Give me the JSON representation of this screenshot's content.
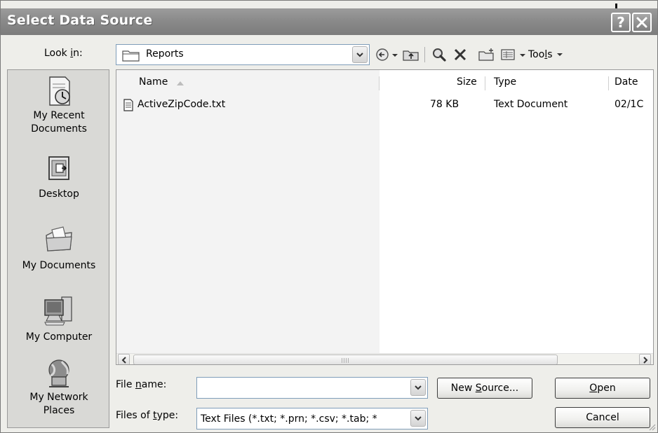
{
  "window": {
    "title": "Select Data Source",
    "help_glyph": "?",
    "close_glyph": "X"
  },
  "lookin": {
    "label_pre": "Look ",
    "label_key": "i",
    "label_post": "n:",
    "value": "Reports"
  },
  "toolbar": {
    "items": [
      "back-icon",
      "up-folder-icon",
      "search-web-icon",
      "delete-icon",
      "new-folder-icon",
      "views-icon"
    ],
    "tools_pre": "Too",
    "tools_key": "l",
    "tools_post": "s"
  },
  "places": [
    {
      "label_line1": "My Recent",
      "label_line2": "Documents",
      "icon": "recent-documents-icon"
    },
    {
      "label_line1": "Desktop",
      "label_line2": "",
      "icon": "desktop-icon"
    },
    {
      "label_line1": "My Documents",
      "label_line2": "",
      "icon": "my-documents-icon"
    },
    {
      "label_line1": "My Computer",
      "label_line2": "",
      "icon": "my-computer-icon"
    },
    {
      "label_line1": "My Network",
      "label_line2": "Places",
      "icon": "network-places-icon"
    }
  ],
  "filelist": {
    "columns": [
      "Name",
      "Size",
      "Type",
      "Date"
    ],
    "sort_column": "Name",
    "rows": [
      {
        "name": "ActiveZipCode.txt",
        "size": "78 KB",
        "type": "Text Document",
        "date": "02/1C"
      }
    ]
  },
  "filename": {
    "label_pre": "File ",
    "label_key": "n",
    "label_post": "ame:",
    "value": ""
  },
  "filetype": {
    "label_pre": "Files of ",
    "label_key": "t",
    "label_post": "ype:",
    "value": "Text Files (*.txt; *.prn; *.csv; *.tab; *"
  },
  "buttons": {
    "new_source_pre": "New ",
    "new_source_key": "S",
    "new_source_post": "ource...",
    "open_key": "O",
    "open_post": "pen",
    "cancel": "Cancel"
  },
  "colors": {
    "titlebar": "#8a8a8a",
    "dialog_bg": "#eeeeea",
    "places_bg": "#d9d9d6",
    "list_bg": "#ffffff"
  }
}
